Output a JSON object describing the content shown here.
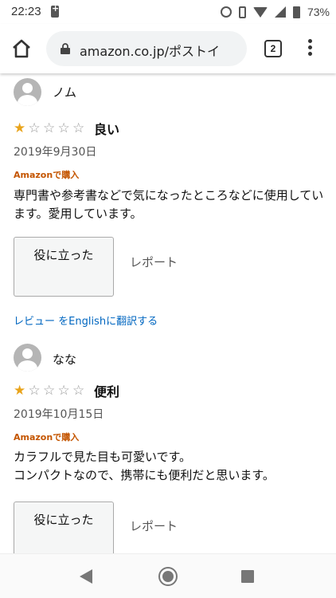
{
  "status_bar": {
    "time": "22:23",
    "battery_pct": "73%"
  },
  "browser": {
    "url": "amazon.co.jp/ポストイ",
    "tab_count": "2"
  },
  "reviews": [
    {
      "reviewer": "ノム",
      "rating": 1,
      "title": "良い",
      "date": "2019年9月30日",
      "verified": "Amazonで購入",
      "body": "専門書や参考書などで気になったところなどに使用しています。愛用しています。",
      "helpful_label": "役に立った",
      "report_label": "レポート",
      "translate_label": "レビュー をEnglishに翻訳する"
    },
    {
      "reviewer": "なな",
      "rating": 1,
      "title": "便利",
      "date": "2019年10月15日",
      "verified": "Amazonで購入",
      "body": "カラフルで見た目も可愛いです。\nコンパクトなので、携帯にも便利だと思います。",
      "helpful_label": "役に立った",
      "report_label": "レポート"
    }
  ],
  "colors": {
    "star_filled": "#e9a41c",
    "verified": "#c45500",
    "link": "#0066c0"
  },
  "icons": [
    "home-icon",
    "lock-icon",
    "tab-switcher-icon",
    "more-menu-icon",
    "avatar-icon",
    "star-icon",
    "back-icon",
    "circle-home-icon",
    "recents-icon"
  ]
}
